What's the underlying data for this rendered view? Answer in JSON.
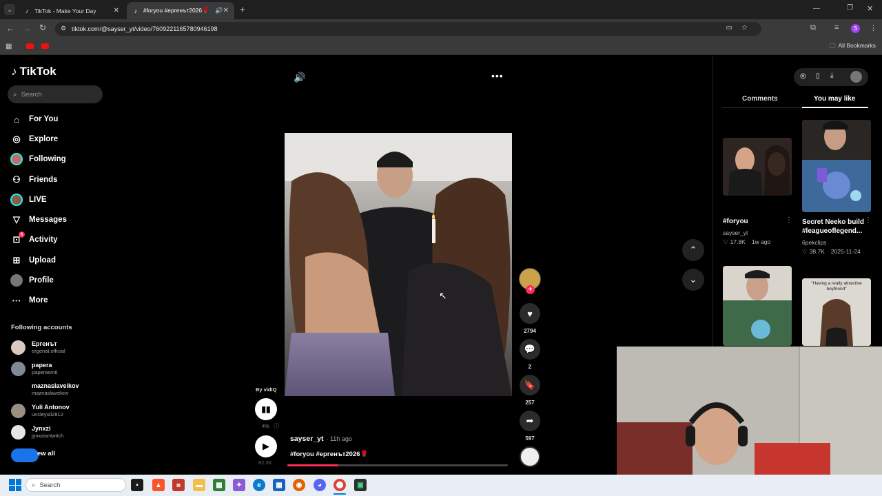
{
  "browser": {
    "tabs": [
      {
        "title": "TikTok - Make Your Day",
        "active": false
      },
      {
        "title": "#foryou #ергенът2026🌹 |",
        "active": true
      }
    ],
    "url": "tiktok.com/@sayser_yt/video/7609221165780946198",
    "bookmarks_label": "All Bookmarks",
    "profile_initial": "S"
  },
  "tiktok": {
    "logo": "TikTok",
    "search_placeholder": "Search",
    "nav": [
      {
        "label": "For You",
        "icon": "home-icon"
      },
      {
        "label": "Explore",
        "icon": "compass-icon"
      },
      {
        "label": "Following",
        "icon": "following-avatar-icon"
      },
      {
        "label": "Friends",
        "icon": "friends-icon"
      },
      {
        "label": "LIVE",
        "icon": "live-icon"
      },
      {
        "label": "Messages",
        "icon": "send-icon"
      },
      {
        "label": "Activity",
        "icon": "activity-icon",
        "badge": "6"
      },
      {
        "label": "Upload",
        "icon": "plus-square-icon"
      },
      {
        "label": "Profile",
        "icon": "profile-avatar-icon"
      },
      {
        "label": "More",
        "icon": "more-dots-icon"
      }
    ],
    "following_title": "Following accounts",
    "accounts": [
      {
        "name": "Ергенът",
        "handle": "ergenat.official",
        "color": "#d9c9c0"
      },
      {
        "name": "papera",
        "handle": "paperasm6",
        "color": "#7f8a96"
      },
      {
        "name": "maznaslaveikov",
        "handle": "maznaslaveikov",
        "color": "#000000"
      },
      {
        "name": "Yuli Antonov",
        "handle": "uncleyuli2812",
        "color": "#9a8f82"
      },
      {
        "name": "Jynxzi",
        "handle": "jynxziontwitch",
        "color": "#e5e5e5"
      }
    ],
    "view_all": "ew all"
  },
  "video": {
    "vidiq_label": "By vidIQ",
    "vidiq_percent": "4%",
    "views": "82.3K",
    "author": "sayser_yt",
    "time_ago": "· 11h ago",
    "caption": "#foryou #ергенът2026🌹",
    "progress_fraction": 0.23,
    "actions": {
      "likes": "2794",
      "comments": "2",
      "saves": "257",
      "shares": "597"
    }
  },
  "right_panel": {
    "tabs": [
      "Comments",
      "You may like"
    ],
    "active_tab": "You may like",
    "cards": [
      {
        "title": "#foryou",
        "author": "sayser_yt",
        "likes": "17.8K",
        "date": "1w ago"
      },
      {
        "title": "Secret Neeko build #leagueoflegend...",
        "author": "6pekclips",
        "likes": "38.7K",
        "date": "2025-11-24"
      },
      {
        "overlay_text": "\"Having a really attractive boyfriend\""
      }
    ]
  },
  "taskbar": {
    "search_placeholder": "Search"
  },
  "colors": {
    "accent": "#fe2c55",
    "teal": "#25f4ee",
    "bg": "#000000"
  }
}
